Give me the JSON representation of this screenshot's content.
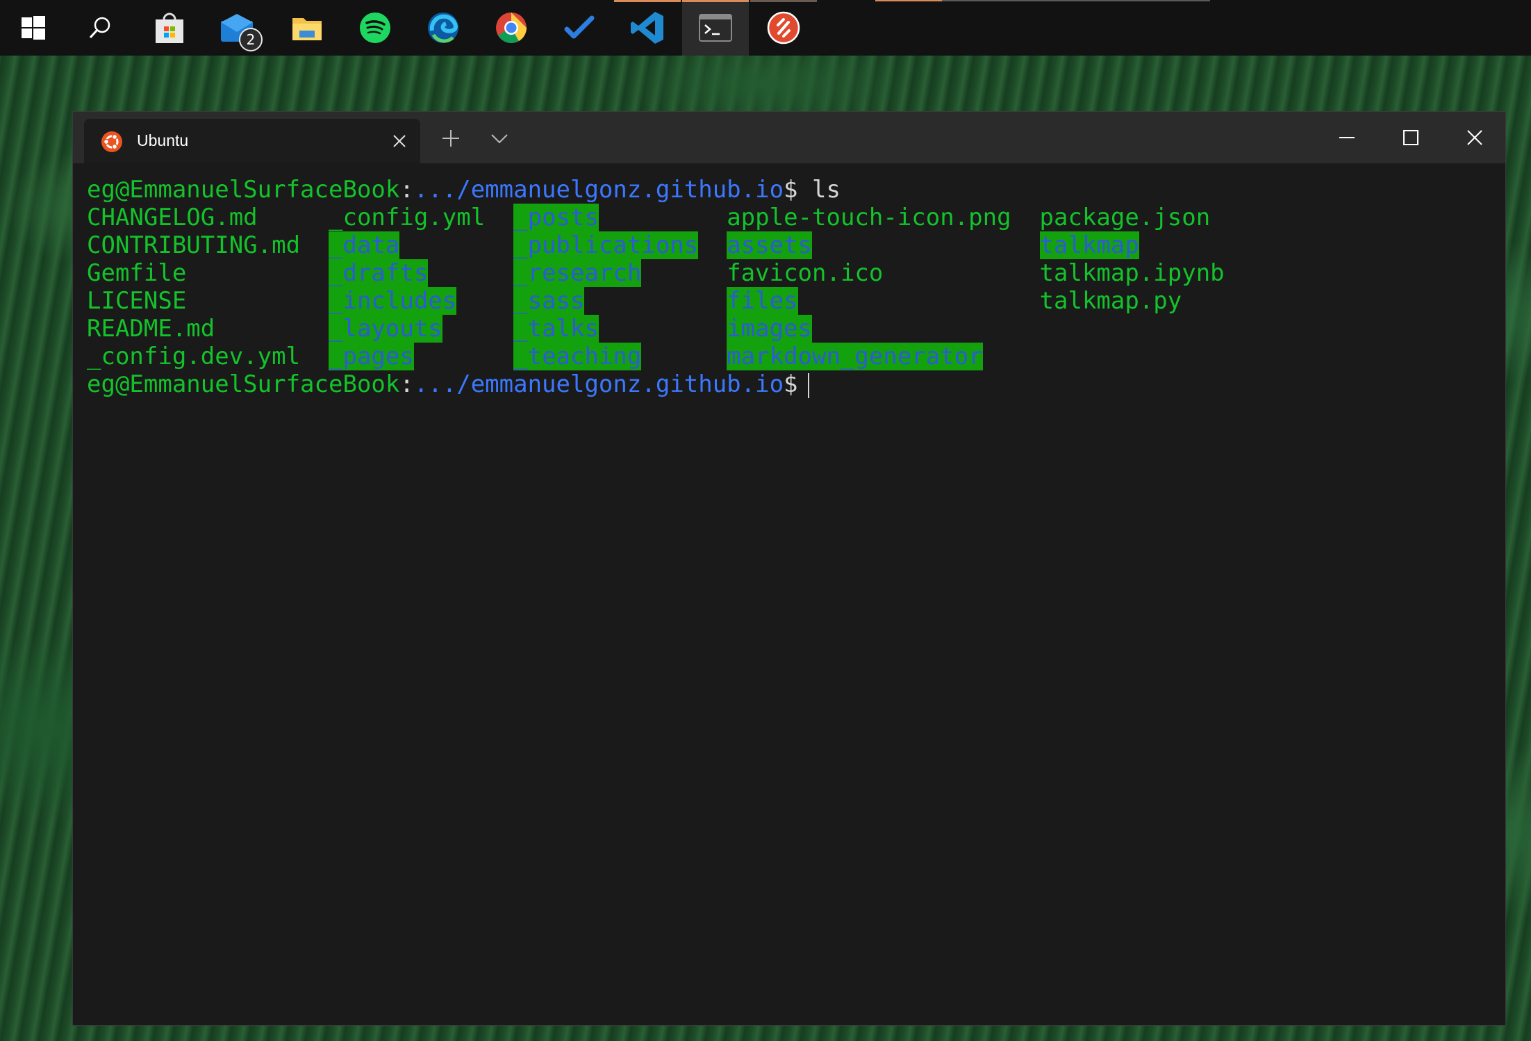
{
  "taskbar": {
    "icons": [
      "windows-start-icon",
      "search-icon",
      "store-icon",
      "mail-icon",
      "file-explorer-icon",
      "spotify-icon",
      "edge-icon",
      "chrome-icon",
      "todo-icon",
      "vscode-icon",
      "terminal-icon",
      "remote-desktop-icon"
    ],
    "mail_badge": "2"
  },
  "window": {
    "tab_title": "Ubuntu",
    "tab_icon": "ubuntu-icon"
  },
  "terminal": {
    "prompt_user": "eg@EmmanuelSurfaceBook",
    "prompt_sep": ":",
    "prompt_path": ".../emmanuelgonz.github.io",
    "prompt_symbol": "$",
    "command": "ls",
    "col1": [
      "CHANGELOG.md",
      "CONTRIBUTING.md",
      "Gemfile",
      "LICENSE",
      "README.md",
      "_config.dev.yml"
    ],
    "col2": [
      "_config.yml",
      "_data",
      "_drafts",
      "_includes",
      "_layouts",
      "_pages"
    ],
    "col3": [
      "_posts",
      "_publications",
      "_research",
      "_sass",
      "_talks",
      "_teaching"
    ],
    "col4": [
      "apple-touch-icon.png",
      "assets",
      "favicon.ico",
      "files",
      "images",
      "markdown_generator"
    ],
    "col5": [
      "package.json",
      "talkmap",
      "talkmap.ipynb",
      "talkmap.py"
    ]
  },
  "colors": {
    "terminal_green": "#13c32a",
    "dir_highlight_bg": "#13a10e",
    "dir_text_blue": "#2d5bd6",
    "path_blue": "#3b78ff"
  }
}
